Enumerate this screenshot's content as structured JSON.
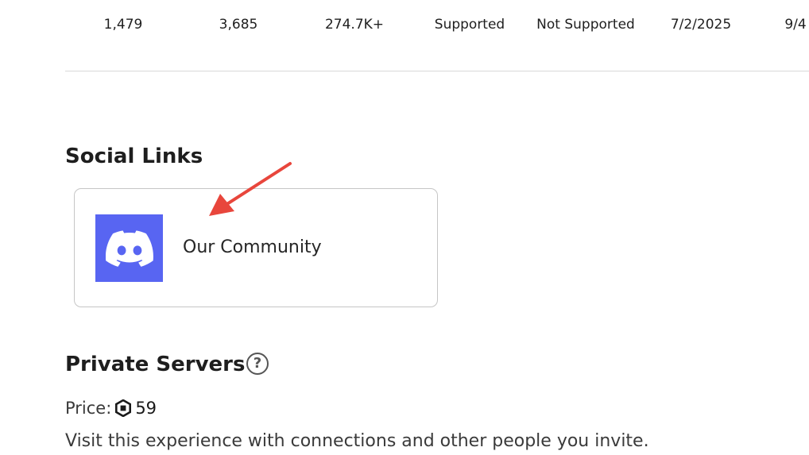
{
  "stats": {
    "values": [
      "1,479",
      "3,685",
      "274.7K+",
      "Supported",
      "Not Supported",
      "7/2/2025",
      "9/4"
    ]
  },
  "social_links": {
    "title": "Social Links",
    "items": [
      {
        "label": "Our Community",
        "icon": "discord-icon"
      }
    ]
  },
  "private_servers": {
    "title": "Private Servers",
    "help_symbol": "?",
    "price_label": "Price:",
    "price_value": "59",
    "description": "Visit this experience with connections and other people you invite."
  },
  "colors": {
    "discord": "#5865f2",
    "annotation": "#e8463c",
    "divider": "#d9d9d9",
    "card_border": "#c6c6c6"
  }
}
